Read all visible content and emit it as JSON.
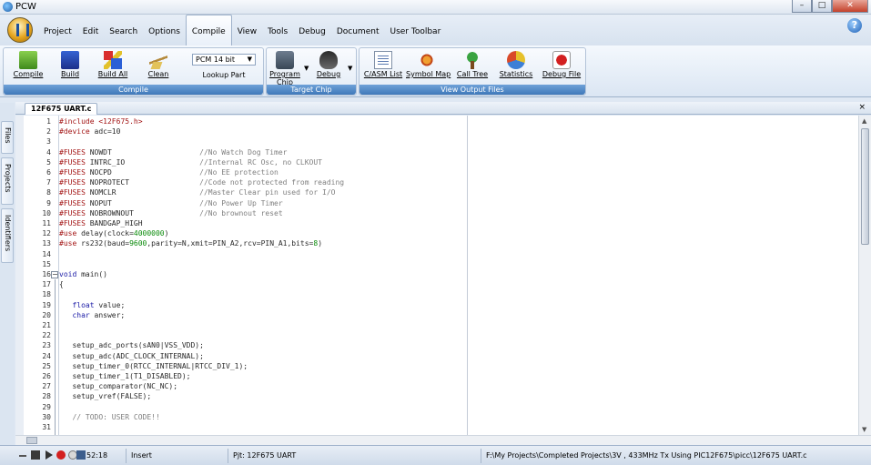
{
  "window": {
    "title": "PCW"
  },
  "menu": {
    "items": [
      "Project",
      "Edit",
      "Search",
      "Options",
      "Compile",
      "View",
      "Tools",
      "Debug",
      "Document",
      "User Toolbar"
    ],
    "active": "Compile"
  },
  "ribbon": {
    "compile_group": {
      "label": "Compile",
      "buttons": [
        "Compile",
        "Build",
        "Build All",
        "Clean"
      ],
      "compiler_select": "PCM 14 bit",
      "lookup_part": "Lookup Part"
    },
    "target_chip_group": {
      "label": "Target Chip",
      "program_chip_line1": "Program",
      "program_chip_line2": "Chip",
      "debug": "Debug"
    },
    "output_group": {
      "label": "View Output Files",
      "buttons": [
        "C/ASM List",
        "Symbol Map",
        "Call Tree",
        "Statistics",
        "Debug File"
      ]
    }
  },
  "sidetabs": [
    "Files",
    "Projects",
    "Identifiers"
  ],
  "document": {
    "tab": "12F675 UART.c",
    "close": "×"
  },
  "editor": {
    "line_numbers": [
      "1",
      "2",
      "3",
      "4",
      "5",
      "6",
      "7",
      "8",
      "9",
      "10",
      "11",
      "12",
      "13",
      "14",
      "15",
      "16",
      "17",
      "18",
      "19",
      "20",
      "21",
      "22",
      "23",
      "24",
      "25",
      "26",
      "27",
      "28",
      "29",
      "30",
      "31"
    ],
    "lines": [
      [
        {
          "t": "#include ",
          "c": "#a31515"
        },
        {
          "t": "<12F675.h>",
          "c": "#a31515"
        }
      ],
      [
        {
          "t": "#device ",
          "c": "#a31515"
        },
        {
          "t": "adc=10",
          "c": "#2a2a2a"
        }
      ],
      [],
      [
        {
          "t": "#FUSES ",
          "c": "#a31515"
        },
        {
          "t": "NOWDT                    ",
          "c": "#2a2a2a"
        },
        {
          "t": "//No Watch Dog Timer",
          "c": "#808080"
        }
      ],
      [
        {
          "t": "#FUSES ",
          "c": "#a31515"
        },
        {
          "t": "INTRC_IO                 ",
          "c": "#2a2a2a"
        },
        {
          "t": "//Internal RC Osc, no CLKOUT",
          "c": "#808080"
        }
      ],
      [
        {
          "t": "#FUSES ",
          "c": "#a31515"
        },
        {
          "t": "NOCPD                    ",
          "c": "#2a2a2a"
        },
        {
          "t": "//No EE protection",
          "c": "#808080"
        }
      ],
      [
        {
          "t": "#FUSES ",
          "c": "#a31515"
        },
        {
          "t": "NOPROTECT                ",
          "c": "#2a2a2a"
        },
        {
          "t": "//Code not protected from reading",
          "c": "#808080"
        }
      ],
      [
        {
          "t": "#FUSES ",
          "c": "#a31515"
        },
        {
          "t": "NOMCLR                   ",
          "c": "#2a2a2a"
        },
        {
          "t": "//Master Clear pin used for I/O",
          "c": "#808080"
        }
      ],
      [
        {
          "t": "#FUSES ",
          "c": "#a31515"
        },
        {
          "t": "NOPUT                    ",
          "c": "#2a2a2a"
        },
        {
          "t": "//No Power Up Timer",
          "c": "#808080"
        }
      ],
      [
        {
          "t": "#FUSES ",
          "c": "#a31515"
        },
        {
          "t": "NOBROWNOUT               ",
          "c": "#2a2a2a"
        },
        {
          "t": "//No brownout reset",
          "c": "#808080"
        }
      ],
      [
        {
          "t": "#FUSES ",
          "c": "#a31515"
        },
        {
          "t": "BANDGAP_HIGH",
          "c": "#2a2a2a"
        }
      ],
      [
        {
          "t": "#use ",
          "c": "#a31515"
        },
        {
          "t": "delay(clock=",
          "c": "#2a2a2a"
        },
        {
          "t": "4000000",
          "c": "#0a8a0a"
        },
        {
          "t": ")",
          "c": "#2a2a2a"
        }
      ],
      [
        {
          "t": "#use ",
          "c": "#a31515"
        },
        {
          "t": "rs232(baud=",
          "c": "#2a2a2a"
        },
        {
          "t": "9600",
          "c": "#0a8a0a"
        },
        {
          "t": ",parity=N,xmit=PIN_A2,rcv=PIN_A1,bits=",
          "c": "#2a2a2a"
        },
        {
          "t": "8",
          "c": "#0a8a0a"
        },
        {
          "t": ")",
          "c": "#2a2a2a"
        }
      ],
      [],
      [],
      [
        {
          "t": "void ",
          "c": "#1a1aa6"
        },
        {
          "t": "main()",
          "c": "#2a2a2a"
        }
      ],
      [
        {
          "t": "{",
          "c": "#2a2a2a"
        }
      ],
      [],
      [
        {
          "t": "   float ",
          "c": "#1a1aa6"
        },
        {
          "t": "value;",
          "c": "#2a2a2a"
        }
      ],
      [
        {
          "t": "   char ",
          "c": "#1a1aa6"
        },
        {
          "t": "answer;",
          "c": "#2a2a2a"
        }
      ],
      [],
      [],
      [
        {
          "t": "   setup_adc_ports(sAN0|VSS_VDD);",
          "c": "#2a2a2a"
        }
      ],
      [
        {
          "t": "   setup_adc(ADC_CLOCK_INTERNAL);",
          "c": "#2a2a2a"
        }
      ],
      [
        {
          "t": "   setup_timer_0(RTCC_INTERNAL|RTCC_DIV_1);",
          "c": "#2a2a2a"
        }
      ],
      [
        {
          "t": "   setup_timer_1(T1_DISABLED);",
          "c": "#2a2a2a"
        }
      ],
      [
        {
          "t": "   setup_comparator(NC_NC);",
          "c": "#2a2a2a"
        }
      ],
      [
        {
          "t": "   setup_vref(FALSE);",
          "c": "#2a2a2a"
        }
      ],
      [],
      [
        {
          "t": "   // TODO: USER CODE!!",
          "c": "#808080"
        }
      ],
      []
    ]
  },
  "status": {
    "position": "52:18",
    "mode": "Insert",
    "project": "Pjt: 12F675 UART",
    "path": "F:\\My Projects\\Completed Projects\\3V , 433MHz  Tx Using PIC12F675\\picc\\12F675 UART.c"
  }
}
